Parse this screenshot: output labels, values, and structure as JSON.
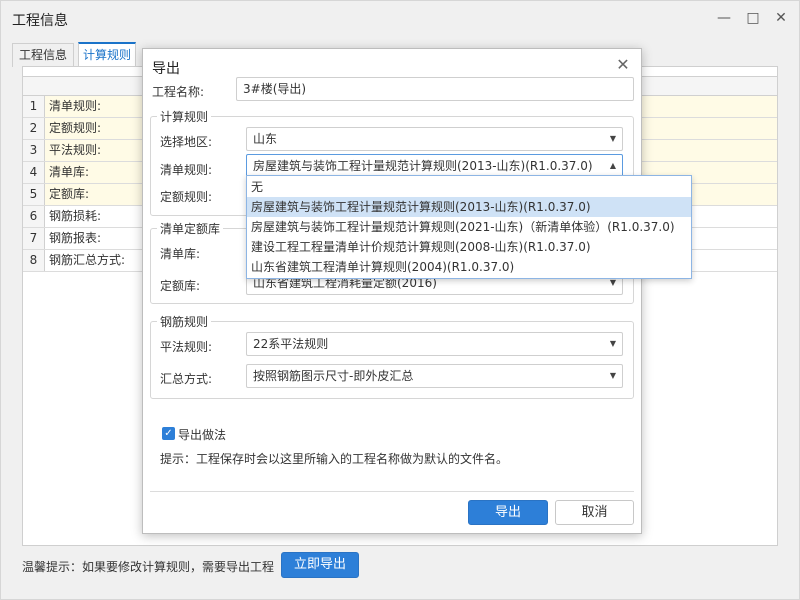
{
  "window": {
    "title": "工程信息",
    "minimize_icon": "minimize-icon",
    "maximize_icon": "maximize-icon",
    "close_icon": "close-icon"
  },
  "tabs": [
    {
      "label": "工程信息"
    },
    {
      "label": "计算规则"
    }
  ],
  "rules_table": {
    "rows": [
      {
        "no": "1",
        "label": "清单规则:"
      },
      {
        "no": "2",
        "label": "定额规则:"
      },
      {
        "no": "3",
        "label": "平法规则:"
      },
      {
        "no": "4",
        "label": "清单库:"
      },
      {
        "no": "5",
        "label": "定额库:"
      },
      {
        "no": "6",
        "label": "钢筋损耗:"
      },
      {
        "no": "7",
        "label": "钢筋报表:"
      },
      {
        "no": "8",
        "label": "钢筋汇总方式:"
      }
    ],
    "highlight_color": "#fffbe6"
  },
  "footer": {
    "tip": "温馨提示：如果要修改计算规则，需要导出工程",
    "export_now": "立即导出"
  },
  "dialog": {
    "title": "导出",
    "project_name_label": "工程名称:",
    "project_name_value": "3#楼(导出)",
    "calc_rules": {
      "group_title": "计算规则",
      "region_label": "选择地区:",
      "region_value": "山东",
      "bill_rule_label": "清单规则:",
      "bill_rule_value": "房屋建筑与装饰工程计量规范计算规则(2013-山东)(R1.0.37.0)",
      "quota_rule_label": "定额规则:"
    },
    "bill_quota_lib": {
      "group_title": "清单定额库",
      "bill_lib_label": "清单库:",
      "quota_lib_label": "定额库:",
      "quota_lib_value": "山东省建筑工程消耗量定额(2016)"
    },
    "rebar_rules": {
      "group_title": "钢筋规则",
      "flat_rule_label": "平法规则:",
      "flat_rule_value": "22系平法规则",
      "summary_label": "汇总方式:",
      "summary_value": "按照钢筋图示尺寸-即外皮汇总"
    },
    "export_method": {
      "label": "导出做法",
      "checked": true
    },
    "hint": "提示：工程保存时会以这里所输入的工程名称做为默认的文件名。",
    "ok_label": "导出",
    "cancel_label": "取消"
  },
  "bill_rule_dropdown": {
    "options": [
      "无",
      "房屋建筑与装饰工程计量规范计算规则(2013-山东)(R1.0.37.0)",
      "房屋建筑与装饰工程计量规范计算规则(2021-山东)（新清单体验）(R1.0.37.0)",
      "建设工程工程量清单计价规范计算规则(2008-山东)(R1.0.37.0)",
      "山东省建筑工程清单计算规则(2004)(R1.0.37.0)"
    ],
    "selected_index": 1
  },
  "colors": {
    "accent": "#2d7fd8",
    "tab_active": "#1a73c9",
    "dropdown_selected": "#cfe2f6"
  }
}
